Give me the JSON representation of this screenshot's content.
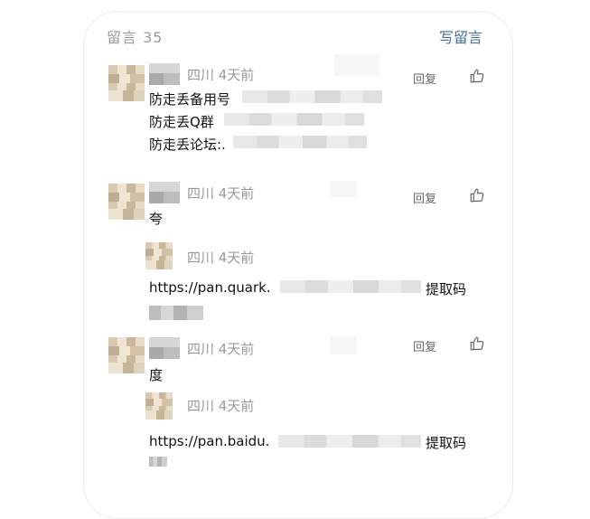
{
  "header": {
    "count_label": "留言 35",
    "write_label": "写留言"
  },
  "comments": [
    {
      "meta": "四川 4天前",
      "reply": "回复",
      "lines": [
        "防走丢备用号",
        "防走丢Q群",
        "防走丢论坛:."
      ]
    },
    {
      "meta": "四川 4天前",
      "reply": "回复",
      "lines": [
        "夸"
      ],
      "replies": [
        {
          "meta": "四川 4天前",
          "line": "https://pan.quark.",
          "suffix": "提取码"
        }
      ]
    },
    {
      "meta": "四川 4天前",
      "reply": "回复",
      "lines": [
        "度"
      ],
      "replies": [
        {
          "meta": "四川 4天前",
          "line": "https://pan.baidu.",
          "suffix": "提取码"
        }
      ]
    }
  ]
}
